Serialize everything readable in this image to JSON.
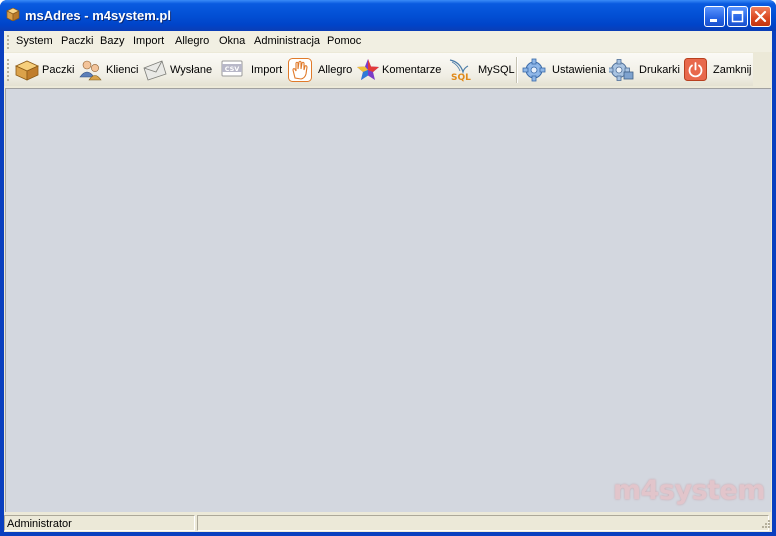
{
  "window": {
    "title": "msAdres - m4system.pl"
  },
  "menu": [
    {
      "label": "System"
    },
    {
      "label": "Paczki"
    },
    {
      "label": "Bazy"
    },
    {
      "label": "Import"
    },
    {
      "label": "Allegro"
    },
    {
      "label": "Okna"
    },
    {
      "label": "Administracja"
    },
    {
      "label": "Pomoc"
    }
  ],
  "toolbar": [
    {
      "label": "Paczki",
      "icon": "package-icon"
    },
    {
      "label": "Klienci",
      "icon": "clients-icon"
    },
    {
      "label": "Wysłane",
      "icon": "envelope-icon"
    },
    {
      "label": "Import",
      "icon": "csv-icon"
    },
    {
      "label": "Allegro",
      "icon": "hand-icon"
    },
    {
      "label": "Komentarze",
      "icon": "star-icon"
    },
    {
      "label": "MySQL",
      "icon": "mysql-icon"
    },
    {
      "label": "Ustawienia",
      "icon": "gear-icon"
    },
    {
      "label": "Drukarki",
      "icon": "printer-gear-icon"
    },
    {
      "label": "Zamknij",
      "icon": "power-icon"
    }
  ],
  "watermark": "m4system",
  "status": {
    "user": "Administrator",
    "info": ""
  },
  "colors": {
    "titlebar": "#0a5be0",
    "mdi_background": "#d3d7df",
    "watermark": "#e2c5cb"
  }
}
